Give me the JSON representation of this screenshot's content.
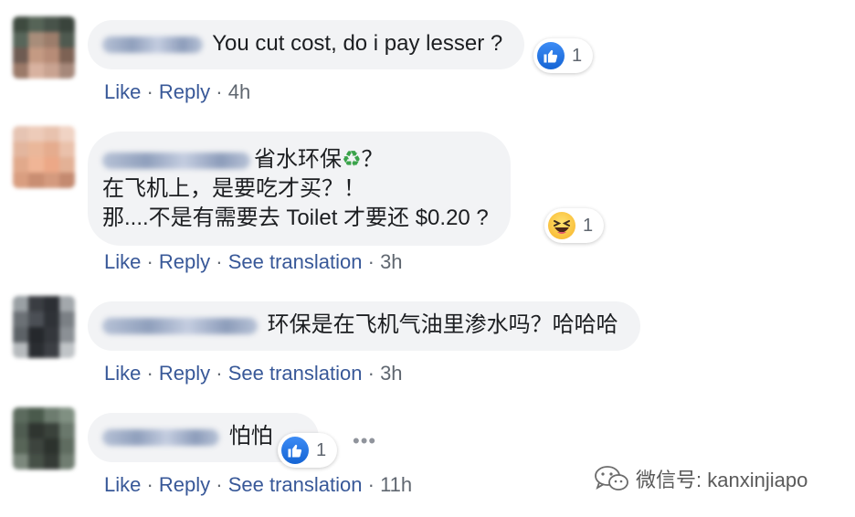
{
  "comments": [
    {
      "lines": [
        "You cut cost, do i pay lesser ?"
      ],
      "reaction": {
        "type": "like-icon",
        "count": "1"
      },
      "actions": {
        "like": "Like",
        "reply": "Reply",
        "time": "4h"
      }
    },
    {
      "lines": [
        "省水环保",
        "？",
        "在飞机上，是要吃才买？！",
        "那....不是有需要去 Toilet 才要还 $0.20 ?"
      ],
      "inline_emoji": "♻",
      "reaction": {
        "type": "haha-icon",
        "count": "1"
      },
      "actions": {
        "like": "Like",
        "reply": "Reply",
        "translate": "See translation",
        "time": "3h"
      }
    },
    {
      "lines": [
        "环保是在飞机气油里渗水吗？哈哈哈"
      ],
      "actions": {
        "like": "Like",
        "reply": "Reply",
        "translate": "See translation",
        "time": "3h"
      }
    },
    {
      "lines": [
        "怕怕"
      ],
      "reaction": {
        "type": "like-icon",
        "count": "1"
      },
      "actions": {
        "like": "Like",
        "reply": "Reply",
        "translate": "See translation",
        "time": "11h"
      },
      "more": "•••"
    }
  ],
  "separator": " · ",
  "watermark": {
    "text": "微信号: kanxinjiapo",
    "icon": "wechat-icon"
  },
  "colors": {
    "link": "#385898",
    "meta": "#606770",
    "bubble": "#f2f3f5",
    "like_blue": "#1877f2",
    "recycle_green": "#3aa34a"
  }
}
